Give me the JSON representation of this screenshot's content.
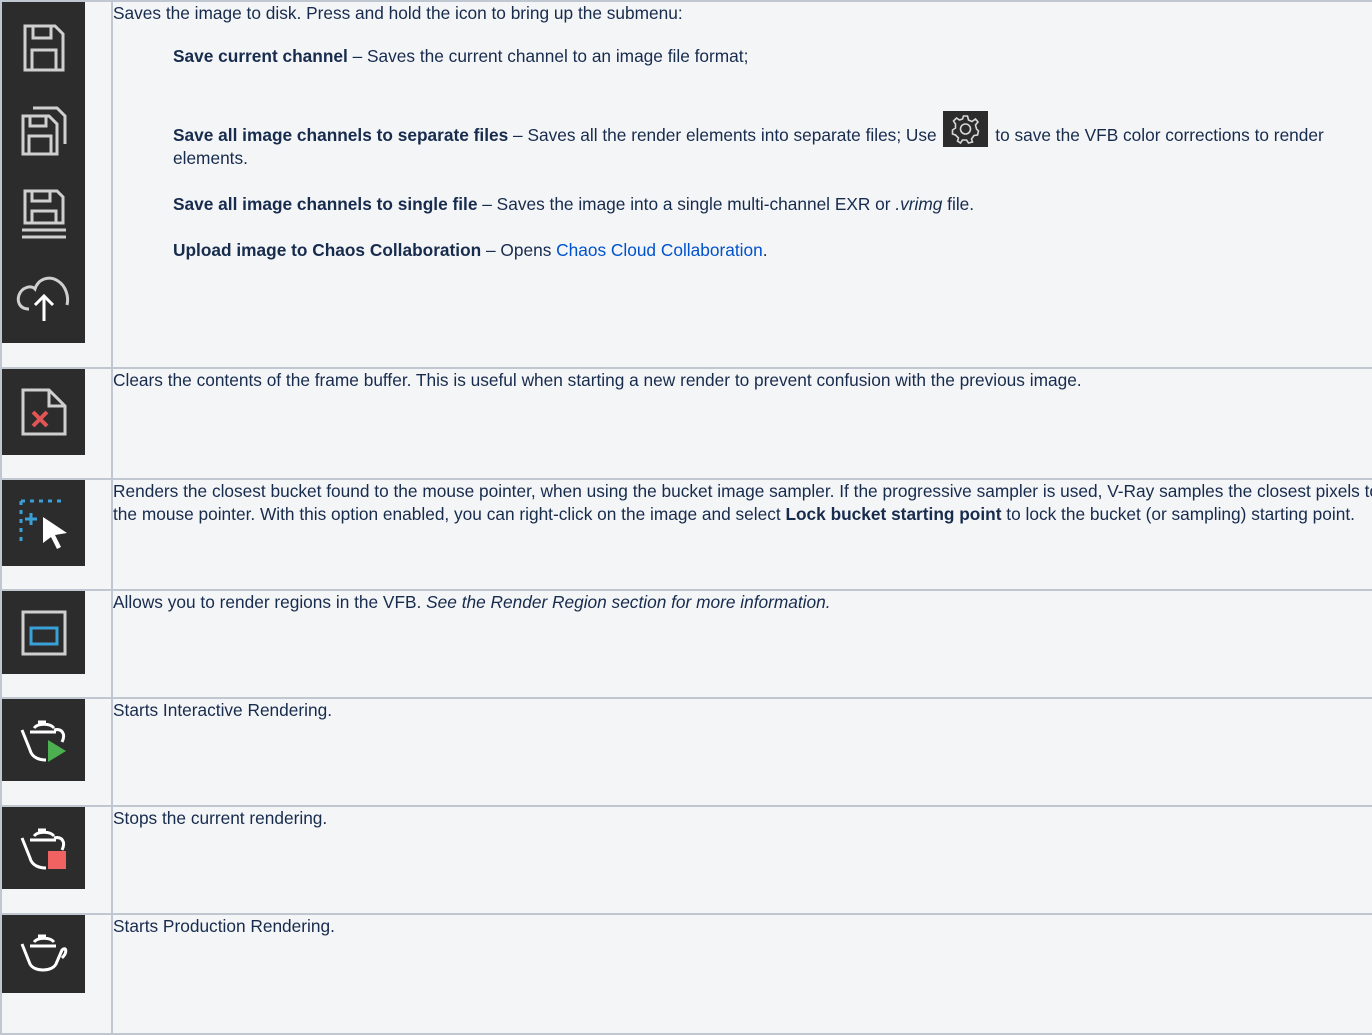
{
  "rows": [
    {
      "icons": [
        "save-icon",
        "save-copy-icon",
        "save-multi-icon",
        "cloud-upload-icon"
      ],
      "intro": "Saves the image to disk. Press and hold the icon to bring up the submenu:",
      "items": [
        {
          "term": "Save current channel",
          "text": " – Saves the current channel to an image file format;"
        },
        {
          "term": "Save all image channels to separate files",
          "text_before_icon": " – Saves all the render elements into separate files; Use ",
          "icon": "gear-icon",
          "text_after_icon": " to save the VFB color corrections to render elements."
        },
        {
          "term": "Save all image channels to single file",
          "text_before_em": " – Saves the image into a single multi-channel EXR or ",
          "em": ".vrimg",
          "text_after_em": " file."
        },
        {
          "term": "Upload image to Chaos Collaboration",
          "text_before_link": " – Opens ",
          "link": "Chaos Cloud Collaboration",
          "text_after_link": "."
        }
      ]
    },
    {
      "icon": "clear-image-icon",
      "text": "Clears the contents of the frame buffer. This is useful when starting a new render to prevent confusion with the previous image."
    },
    {
      "icon": "follow-mouse-icon",
      "text_before_bold": "Renders the closest bucket found to the mouse pointer, when using the bucket image sampler. If the progressive sampler is used, V-Ray samples the closest pixels to the mouse pointer. With this option enabled, you can right-click on the image and select ",
      "bold": "Lock bucket starting point",
      "text_after_bold": " to lock the bucket (or sampling) starting point."
    },
    {
      "icon": "render-region-icon",
      "text_before_em": "Allows you to render regions in the VFB. ",
      "em": "See the Render Region section for more information."
    },
    {
      "icon": "teapot-play-icon",
      "text": "Starts Interactive Rendering."
    },
    {
      "icon": "teapot-stop-icon",
      "text": "Stops the current rendering."
    },
    {
      "icon": "teapot-icon",
      "text": "Starts Production Rendering."
    }
  ],
  "colors": {
    "icon_bg": "#2c2c2c",
    "link": "#0052cc",
    "cell_bg": "#f4f5f7",
    "border": "#c1c7d0",
    "play_green": "#4caf50",
    "stop_red": "#f06262",
    "clear_x": "#e05555",
    "region_blue": "#3aa0d8"
  }
}
